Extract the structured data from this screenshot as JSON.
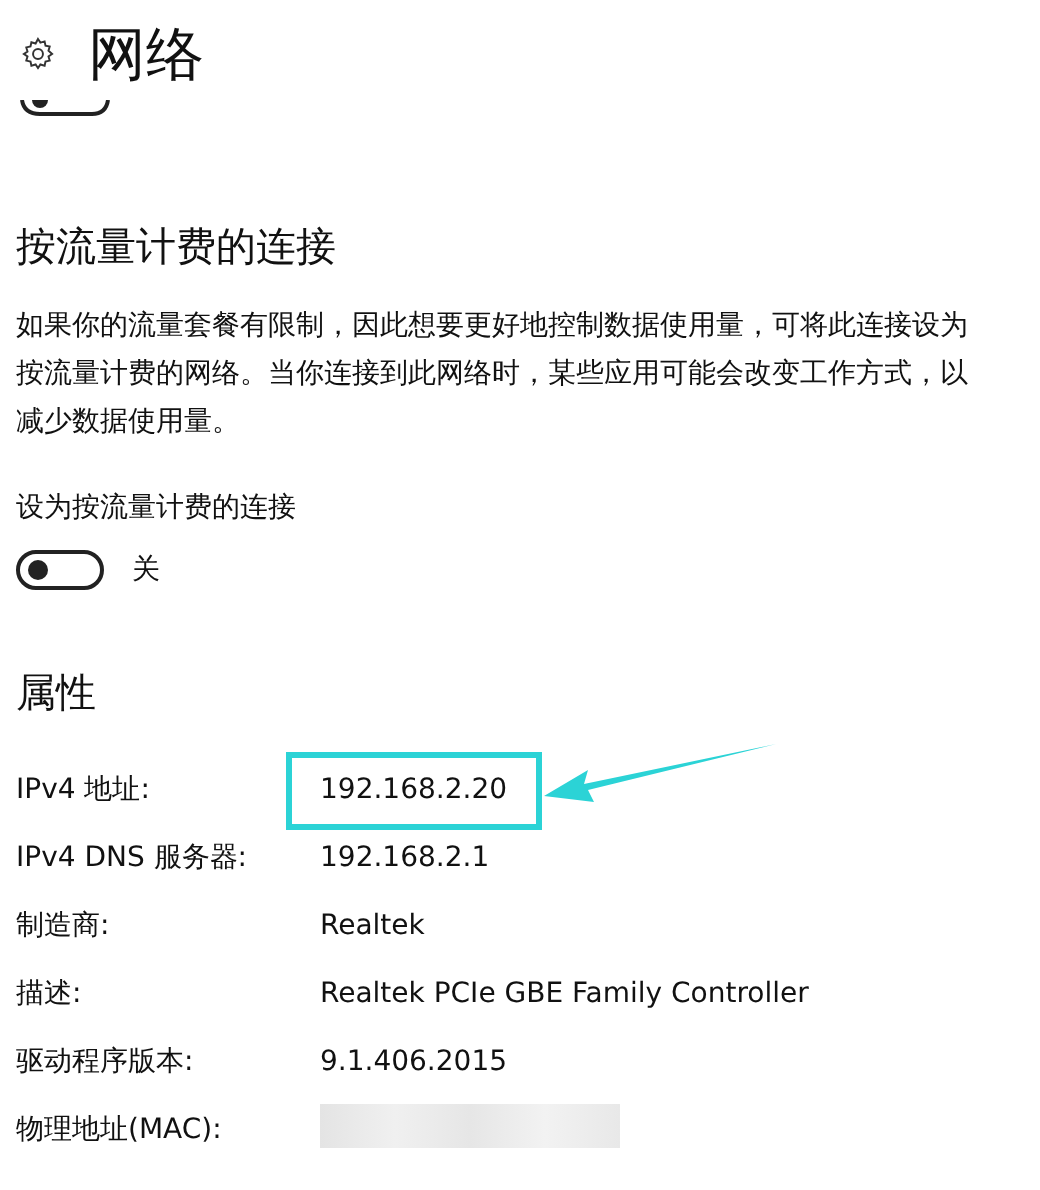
{
  "header": {
    "title": "网络"
  },
  "metered": {
    "heading": "按流量计费的连接",
    "description": "如果你的流量套餐有限制，因此想要更好地控制数据使用量，可将此连接设为按流量计费的网络。当你连接到此网络时，某些应用可能会改变工作方式，以减少数据使用量。",
    "toggle_label": "设为按流量计费的连接",
    "toggle": {
      "on": false,
      "state_text": "关"
    }
  },
  "properties": {
    "heading": "属性",
    "rows": [
      {
        "label": "IPv4 地址:",
        "value": "192.168.2.20",
        "highlighted": true
      },
      {
        "label": "IPv4 DNS 服务器:",
        "value": "192.168.2.1",
        "highlighted": false
      },
      {
        "label": "制造商:",
        "value": "Realtek",
        "highlighted": false
      },
      {
        "label": "描述:",
        "value": "Realtek PCIe GBE Family Controller",
        "highlighted": false
      },
      {
        "label": "驱动程序版本:",
        "value": "9.1.406.2015",
        "highlighted": false
      },
      {
        "label": "物理地址(MAC):",
        "kind": "redacted",
        "highlighted": false
      }
    ]
  }
}
